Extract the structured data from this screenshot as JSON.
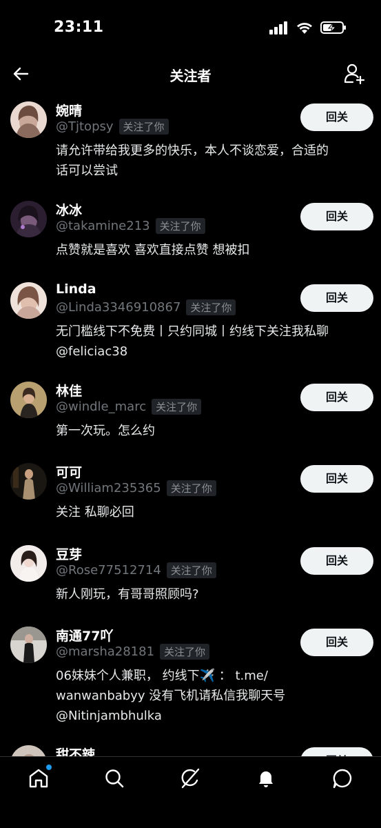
{
  "status_bar": {
    "time": "23:11"
  },
  "header": {
    "title": "关注者"
  },
  "followers": [
    {
      "name": "婉晴",
      "handle": "@Tjtopsy",
      "badge": "关注了你",
      "bio_lines": [
        "请允许带给我更多的快乐，本人不谈恋爱，合适的",
        "话可以尝试"
      ],
      "button": "回关",
      "avatar_color": "#c9a89a"
    },
    {
      "name": "冰冰",
      "handle": "@takamine213",
      "badge": "关注了你",
      "bio_lines": [
        "点赞就是喜欢 喜欢直接点赞 想被扣"
      ],
      "button": "回关",
      "avatar_color": "#4a3550"
    },
    {
      "name": "Linda",
      "handle": "@Linda3346910867",
      "badge": "关注了你",
      "bio_lines": [
        "无门槛线下不免费丨只约同城丨约线下关注我私聊",
        "@feliciac38"
      ],
      "button": "回关",
      "avatar_color": "#d9b8a8"
    },
    {
      "name": "林佳",
      "handle": "@windle_marc",
      "badge": "关注了你",
      "bio_lines": [
        "第一次玩。怎么约"
      ],
      "button": "回关",
      "avatar_color": "#8a7560"
    },
    {
      "name": "可可",
      "handle": "@William235365",
      "badge": "关注了你",
      "bio_lines": [
        "关注 私聊必回"
      ],
      "button": "回关",
      "avatar_color": "#5a4c40"
    },
    {
      "name": "豆芽",
      "handle": "@Rose77512714",
      "badge": "关注了你",
      "bio_lines": [
        "新人刚玩，有哥哥照顾吗?"
      ],
      "button": "回关",
      "avatar_color": "#e6d4d0"
    },
    {
      "name": "南通77吖",
      "handle": "@marsha28181",
      "badge": "关注了你",
      "bio_lines": [
        "06妹妹个人兼职， 约线下✈️ ： t.me/",
        "wanwanbabyy 没有飞机请私信我聊天号",
        "@Nitinjambhulka"
      ],
      "button": "回关",
      "avatar_color": "#b9b5b0"
    },
    {
      "name": "甜不辣",
      "handle": "",
      "badge": "",
      "bio_lines": [],
      "button": "回关",
      "avatar_color": "#9a8a80"
    }
  ],
  "nav": {
    "items": [
      "home-icon",
      "search-icon",
      "grok-icon",
      "notifications-icon",
      "messages-icon"
    ],
    "accent": "#1d9bf0"
  }
}
